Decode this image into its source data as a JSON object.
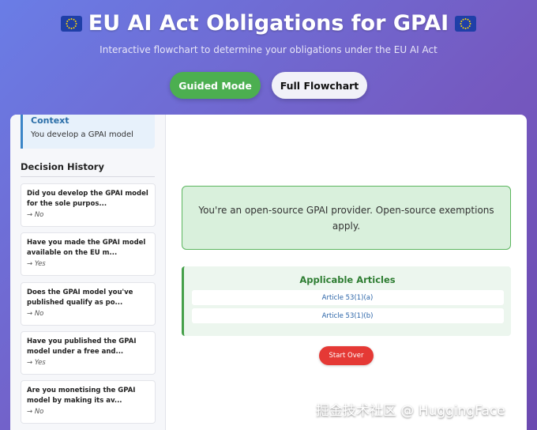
{
  "header": {
    "title": "EU AI Act Obligations for GPAI",
    "subtitle": "Interactive flowchart to determine your obligations under the EU AI Act",
    "flag_icon": "eu-flag-icon"
  },
  "modes": {
    "guided_label": "Guided Mode",
    "full_label": "Full Flowchart"
  },
  "colors": {
    "guided": "#4caf50",
    "accent_blue": "#3a85c8",
    "result_green": "#5cb65f",
    "start_over": "#e53935"
  },
  "sidebar": {
    "context": {
      "title": "Context",
      "text": "You develop a GPAI model"
    },
    "history_title": "Decision History",
    "history": [
      {
        "question": "Did you develop the GPAI model for the sole purpos...",
        "answer": "→ No"
      },
      {
        "question": "Have you made the GPAI model available on the EU m...",
        "answer": "→ Yes"
      },
      {
        "question": "Does the GPAI model you've published qualify as po...",
        "answer": "→ No"
      },
      {
        "question": "Have you published the GPAI model under a free and...",
        "answer": "→ Yes"
      },
      {
        "question": "Are you monetising the GPAI model by making its av...",
        "answer": "→ No"
      }
    ]
  },
  "main": {
    "result": "You're an open-source GPAI provider. Open-source exemptions apply.",
    "articles_title": "Applicable Articles",
    "articles": [
      "Article 53(1)(a)",
      "Article 53(1)(b)"
    ],
    "start_over_label": "Start Over"
  },
  "watermark": "掘金技术社区 @ HuggingFace"
}
